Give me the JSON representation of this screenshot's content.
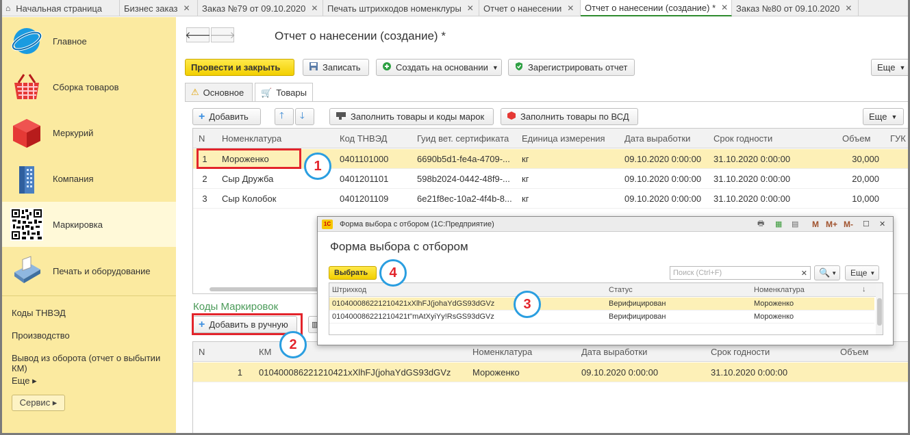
{
  "tabs": [
    {
      "label": "Начальная страница",
      "closable": false
    },
    {
      "label": "Бизнес заказ",
      "closable": true
    },
    {
      "label": "Заказ №79 от 09.10.2020",
      "closable": true
    },
    {
      "label": "Печать штрихкодов номенклуры",
      "closable": true
    },
    {
      "label": "Отчет о нанесении",
      "closable": true
    },
    {
      "label": "Отчет о нанесении (создание) *",
      "closable": true
    },
    {
      "label": "Заказ №80 от 09.10.2020",
      "closable": true
    }
  ],
  "sidebar": {
    "items": [
      {
        "label": "Главное",
        "icon": "globe-icon"
      },
      {
        "label": "Сборка товаров",
        "icon": "basket-icon"
      },
      {
        "label": "Меркурий",
        "icon": "cube-icon"
      },
      {
        "label": "Компания",
        "icon": "building-icon"
      },
      {
        "label": "Маркировка",
        "icon": "qr-code-icon"
      },
      {
        "label": "Печать и оборудование",
        "icon": "printer-icon"
      }
    ],
    "links": [
      "Коды ТНВЭД",
      "Производство",
      "Вывод из оборота (отчет о выбытии КМ)",
      "Еще ▸"
    ],
    "service": "Сервис ▸"
  },
  "header": {
    "title": "Отчет о нанесении (создание) *"
  },
  "toolbar": {
    "post_close": "Провести и закрыть",
    "save": "Записать",
    "create_based": "Создать на основании",
    "register": "Зарегистрировать отчет",
    "more": "Еще"
  },
  "page_tabs": [
    "Основное",
    "Товары"
  ],
  "goods_toolbar": {
    "add": "Добавить",
    "fill_codes": "Заполнить товары и коды марок",
    "fill_vsd": "Заполнить товары по ВСД",
    "more": "Еще"
  },
  "goods_table": {
    "columns": [
      "N",
      "Номенклатура",
      "Код ТНВЭД",
      "Гуид вет. сертификата",
      "Единица измерения",
      "Дата выработки",
      "Срок годности",
      "Объем",
      "ГУК"
    ],
    "rows": [
      [
        "1",
        "Мороженко",
        "0401101000",
        "6690b5d1-fe4a-4709-...",
        "кг",
        "09.10.2020 0:00:00",
        "31.10.2020 0:00:00",
        "30,000"
      ],
      [
        "2",
        "Сыр Дружба",
        "0401201101",
        "598b2024-0442-48f9-...",
        "кг",
        "09.10.2020 0:00:00",
        "31.10.2020 0:00:00",
        "20,000"
      ],
      [
        "3",
        "Сыр Колобок",
        "0401201109",
        "6e21f8ec-10a2-4f4b-8...",
        "кг",
        "09.10.2020 0:00:00",
        "31.10.2020 0:00:00",
        "10,000"
      ]
    ]
  },
  "codes_section": {
    "title": "Коды Маркировок",
    "add_manual": "Добавить в ручную",
    "columns": [
      "N",
      "КМ",
      "Номенклатура",
      "Дата выработки",
      "Срок годности",
      "Объем"
    ],
    "rows": [
      [
        "1",
        "010400086221210421xXlhFJ(johaYdGS93dGVz",
        "Мороженко",
        "09.10.2020 0:00:00",
        "31.10.2020 0:00:00",
        ""
      ]
    ]
  },
  "dialog": {
    "window_title": "Форма выбора с отбором  (1С:Предприятие)",
    "title": "Форма выбора с отбором",
    "select": "Выбрать",
    "search_placeholder": "Поиск (Ctrl+F)",
    "more": "Еще",
    "window_buttons": [
      "M",
      "M+",
      "M-"
    ],
    "columns": [
      "Штрихкод",
      "Статус",
      "Номенклатура"
    ],
    "rows": [
      [
        "010400086221210421xXlhFJ(johaYdGS93dGVz",
        "Верифицирован",
        "Мороженко"
      ],
      [
        "010400086221210421t\"mAtXyiYy!RsGS93dGVz",
        "Верифицирован",
        "Мороженко"
      ]
    ]
  },
  "annotations": [
    "1",
    "2",
    "3",
    "4"
  ],
  "colors": {
    "sidebar": "#fbeaa0",
    "accent_yellow": "#f2cf00",
    "selected_row": "#fdf0b7",
    "highlight_red": "#e3242b",
    "badge_blue": "#2a9ee0",
    "section_green": "#4a9a58"
  }
}
